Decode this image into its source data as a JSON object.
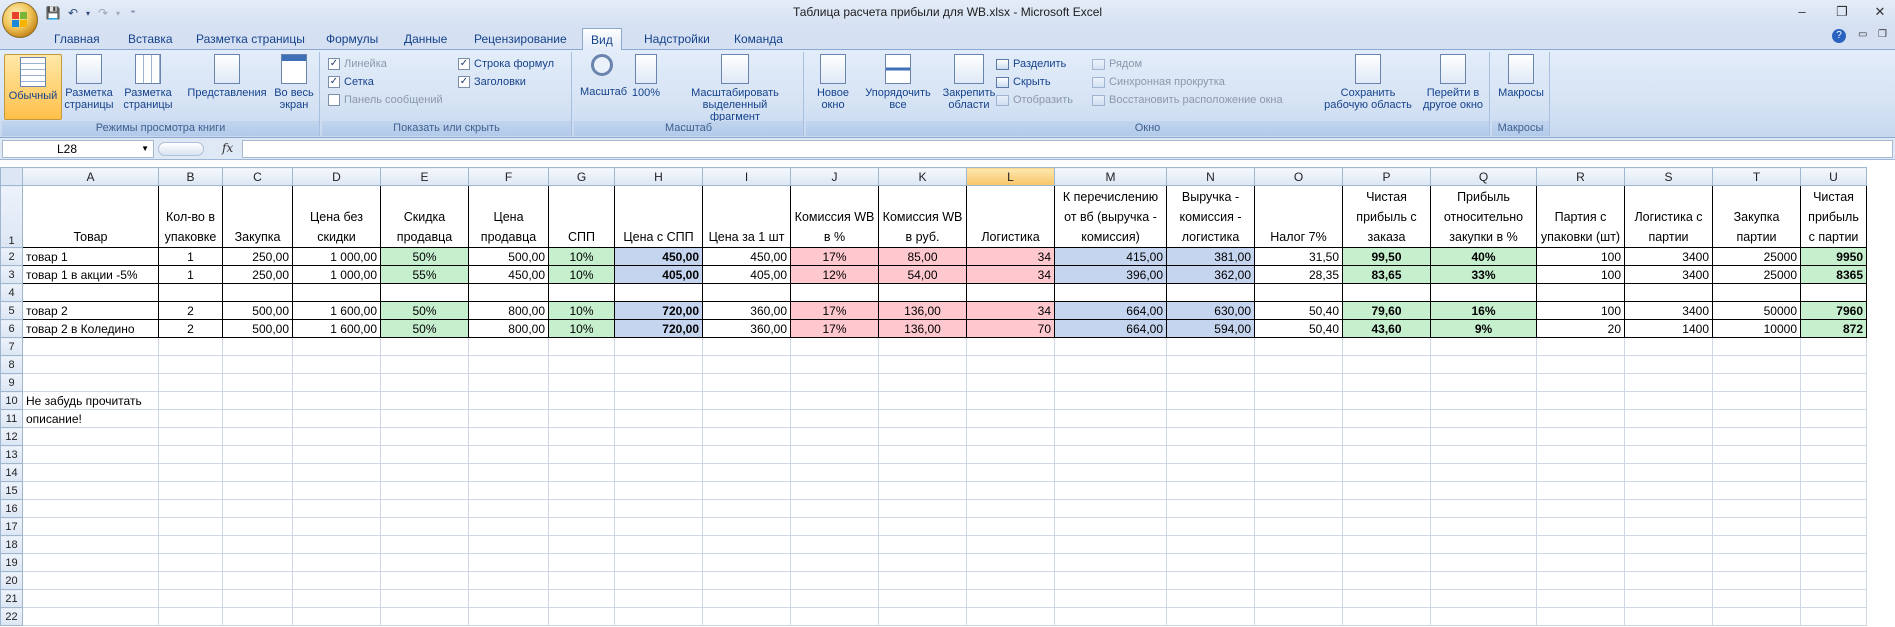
{
  "window": {
    "title": "Таблица расчета прибыли для WB.xlsx - Microsoft Excel",
    "controls": {
      "minimize": "–",
      "restore": "❐",
      "close": "✕"
    }
  },
  "ribbon_tabs": [
    "Главная",
    "Вставка",
    "Разметка страницы",
    "Формулы",
    "Данные",
    "Рецензирование",
    "Вид",
    "Надстройки",
    "Команда"
  ],
  "active_tab": "Вид",
  "ribbon": {
    "views": {
      "label": "Режимы просмотра книги",
      "normal": "Обычный",
      "page_layout": "Разметка страницы",
      "page_break": "Разметка страницы",
      "custom_views": "Представления",
      "full_screen": "Во весь экран"
    },
    "show": {
      "label": "Показать или скрыть",
      "ruler": "Линейка",
      "gridlines": "Сетка",
      "messages": "Панель сообщений",
      "formula_bar": "Строка формул",
      "headings": "Заголовки"
    },
    "zoom": {
      "label": "Масштаб",
      "zoom": "Масштаб",
      "hundred": "100%",
      "to_selection": "Масштабировать выделенный фрагмент"
    },
    "window": {
      "label": "Окно",
      "new_window": "Новое окно",
      "arrange": "Упорядочить все",
      "freeze": "Закрепить области",
      "split": "Разделить",
      "hide": "Скрыть",
      "unhide": "Отобразить",
      "side_by_side": "Рядом",
      "sync_scroll": "Синхронная прокрутка",
      "reset_pos": "Восстановить расположение окна",
      "save_ws": "Сохранить рабочую область",
      "switch": "Перейти в другое окно"
    },
    "macros": {
      "label": "Макросы",
      "macros": "Макросы"
    }
  },
  "formula_bar": {
    "name_box": "L28",
    "fx": "fx",
    "value": ""
  },
  "columns": [
    "A",
    "B",
    "C",
    "D",
    "E",
    "F",
    "G",
    "H",
    "I",
    "J",
    "K",
    "L",
    "M",
    "N",
    "O",
    "P",
    "Q",
    "R",
    "S",
    "T",
    "U"
  ],
  "selected_column": "L",
  "headers": [
    "Товар",
    "Кол-во в упаковке",
    "Закупка",
    "Цена без скидки",
    "Скидка продавца",
    "Цена продавца",
    "СПП",
    "Цена с СПП",
    "Цена за 1 шт",
    "Комиссия WB в %",
    "Комиссия WB в руб.",
    "Логистика",
    "К перечислению от вб (выручка - комиссия)",
    "Выручка - комиссия - логистика",
    "Налог 7%",
    "Чистая прибыль с заказа",
    "Прибыль относительно закупки в %",
    "Партия с упаковки (шт)",
    "Логистика с партии",
    "Закупка партии",
    "Чистая прибыль с партии"
  ],
  "rows": [
    {
      "num": "2",
      "cells": [
        "товар 1",
        "1",
        "250,00",
        "1 000,00",
        "50%",
        "500,00",
        "10%",
        "450,00",
        "450,00",
        "17%",
        "85,00",
        "34",
        "415,00",
        "381,00",
        "31,50",
        "99,50",
        "40%",
        "100",
        "3400",
        "25000",
        "9950"
      ]
    },
    {
      "num": "3",
      "cells": [
        "товар 1 в акции -5%",
        "1",
        "250,00",
        "1 000,00",
        "55%",
        "450,00",
        "10%",
        "405,00",
        "405,00",
        "12%",
        "54,00",
        "34",
        "396,00",
        "362,00",
        "28,35",
        "83,65",
        "33%",
        "100",
        "3400",
        "25000",
        "8365"
      ]
    },
    {
      "num": "5",
      "cells": [
        "товар 2",
        "2",
        "500,00",
        "1 600,00",
        "50%",
        "800,00",
        "10%",
        "720,00",
        "360,00",
        "17%",
        "136,00",
        "34",
        "664,00",
        "630,00",
        "50,40",
        "79,60",
        "16%",
        "100",
        "3400",
        "50000",
        "7960"
      ]
    },
    {
      "num": "6",
      "cells": [
        "товар 2 в Коледино",
        "2",
        "500,00",
        "1 600,00",
        "50%",
        "800,00",
        "10%",
        "720,00",
        "360,00",
        "17%",
        "136,00",
        "70",
        "664,00",
        "594,00",
        "50,40",
        "43,60",
        "9%",
        "20",
        "1400",
        "10000",
        "872"
      ]
    }
  ],
  "note": {
    "line1": "Не забудь прочитать",
    "line2": "описание!"
  },
  "colors": {
    "green": "#c6efce",
    "blue": "#c5d4ef",
    "pink": "#ffc7ce",
    "ribbon": "#d6e3f4"
  }
}
